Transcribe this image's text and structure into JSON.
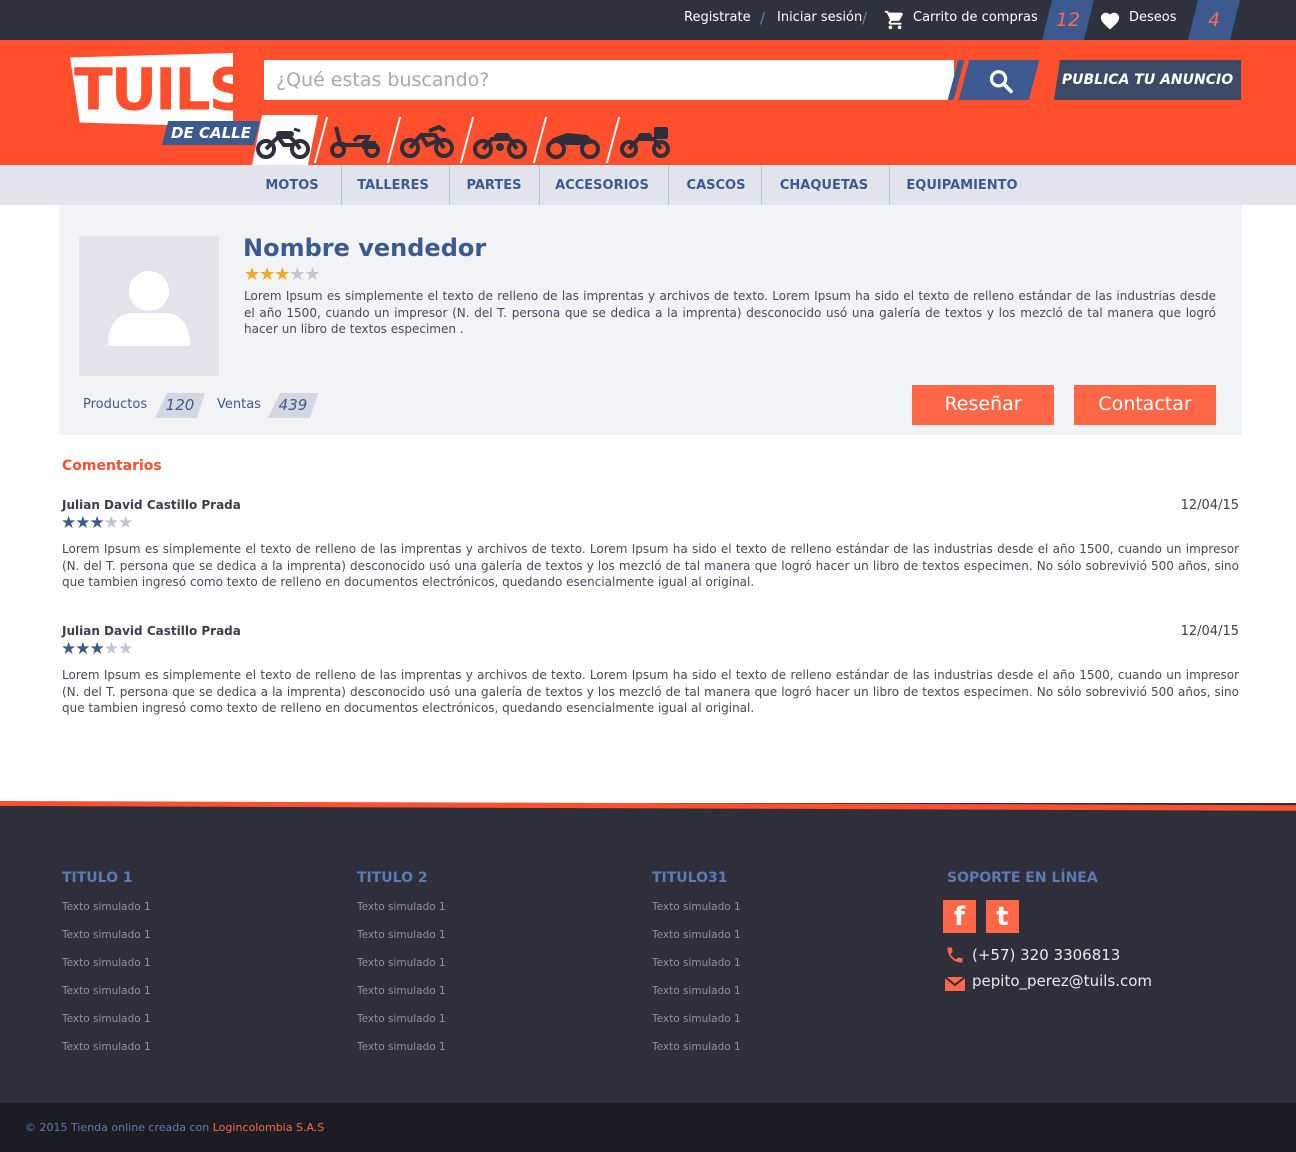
{
  "topbar": {
    "register": "Registrate",
    "login": "Iniciar sesión",
    "cart_label": "Carrito de compras",
    "cart_count": "12",
    "wishlist_label": "Deseos",
    "wishlist_count": "4"
  },
  "header": {
    "logo_text": "TUILS",
    "logo_tag": "DE CALLE",
    "search_placeholder": "¿Qué estas buscando?",
    "publish_button": "PUBLICA TU ANUNCIO",
    "categories": [
      "street-bike-icon",
      "scooter-icon",
      "dirt-bike-icon",
      "cruiser-icon",
      "sport-bike-icon",
      "touring-bike-icon"
    ]
  },
  "nav": [
    "MOTOS",
    "TALLERES",
    "PARTES",
    "ACCESORIOS",
    "CASCOS",
    "CHAQUETAS",
    "EQUIPAMIENTO"
  ],
  "seller": {
    "name": "Nombre vendedor",
    "rating": 3,
    "rating_max": 5,
    "description": "Lorem Ipsum es simplemente el texto de relleno de las imprentas y archivos de texto. Lorem Ipsum ha sido el texto de relleno estándar de las industrias desde el año 1500, cuando un impresor (N. del T. persona que se dedica a la imprenta) desconocido usó una galería de textos y los mezcló de tal manera que logró hacer un libro de textos especimen          .",
    "products_label": "Productos",
    "products_count": "120",
    "sales_label": "Ventas",
    "sales_count": "439",
    "review_button": "Reseñar",
    "contact_button": "Contactar"
  },
  "comments": {
    "title": "Comentarios",
    "items": [
      {
        "author": "Julian David Castillo Prada",
        "date": "12/04/15",
        "rating": 3,
        "text": "Lorem Ipsum es simplemente el texto de relleno de las imprentas y archivos de texto. Lorem Ipsum ha sido el texto de relleno estándar de las industrias desde el año 1500, cuando un impresor (N. del T. persona que se dedica a la imprenta) desconocido usó una galería de textos y los mezcló de tal manera que logró hacer un libro de textos especimen. No sólo sobrevivió 500 años, sino que tambien ingresó como texto de relleno en documentos electrónicos, quedando esencialmente igual al original."
      },
      {
        "author": "Julian David Castillo Prada",
        "date": "12/04/15",
        "rating": 3,
        "text": "Lorem Ipsum es simplemente el texto de relleno de las imprentas y archivos de texto. Lorem Ipsum ha sido el texto de relleno estándar de las industrias desde el año 1500, cuando un impresor (N. del T. persona que se dedica a la imprenta) desconocido usó una galería de textos y los mezcló de tal manera que logró hacer un libro de textos especimen. No sólo sobrevivió 500 años, sino que tambien ingresó como texto de relleno en documentos electrónicos, quedando esencialmente igual al original."
      }
    ]
  },
  "footer": {
    "columns": [
      {
        "title": "TITULO 1",
        "links": [
          "Texto simulado 1",
          "Texto simulado 1",
          "Texto simulado 1",
          "Texto simulado 1",
          "Texto simulado 1",
          "Texto simulado 1"
        ]
      },
      {
        "title": "TITULO 2",
        "links": [
          "Texto simulado 1",
          "Texto simulado 1",
          "Texto simulado 1",
          "Texto simulado 1",
          "Texto simulado 1",
          "Texto simulado 1"
        ]
      },
      {
        "title": "TITULO31",
        "links": [
          "Texto simulado 1",
          "Texto simulado 1",
          "Texto simulado 1",
          "Texto simulado 1",
          "Texto simulado 1",
          "Texto simulado 1"
        ]
      }
    ],
    "support_title": "SOPORTE EN LÍNEA",
    "phone": "(+57) 320 3306813",
    "email": "pepito_perez@tuils.com",
    "copyright": "© 2015 Tienda online creada con ",
    "copyright_link": "Logincolombia S.A.S"
  },
  "colors": {
    "brand_orange": "#ff4f2d",
    "brand_blue": "#3c5a8f",
    "star_gold": "#f5a623",
    "footer_bg": "#2e2f3a"
  }
}
